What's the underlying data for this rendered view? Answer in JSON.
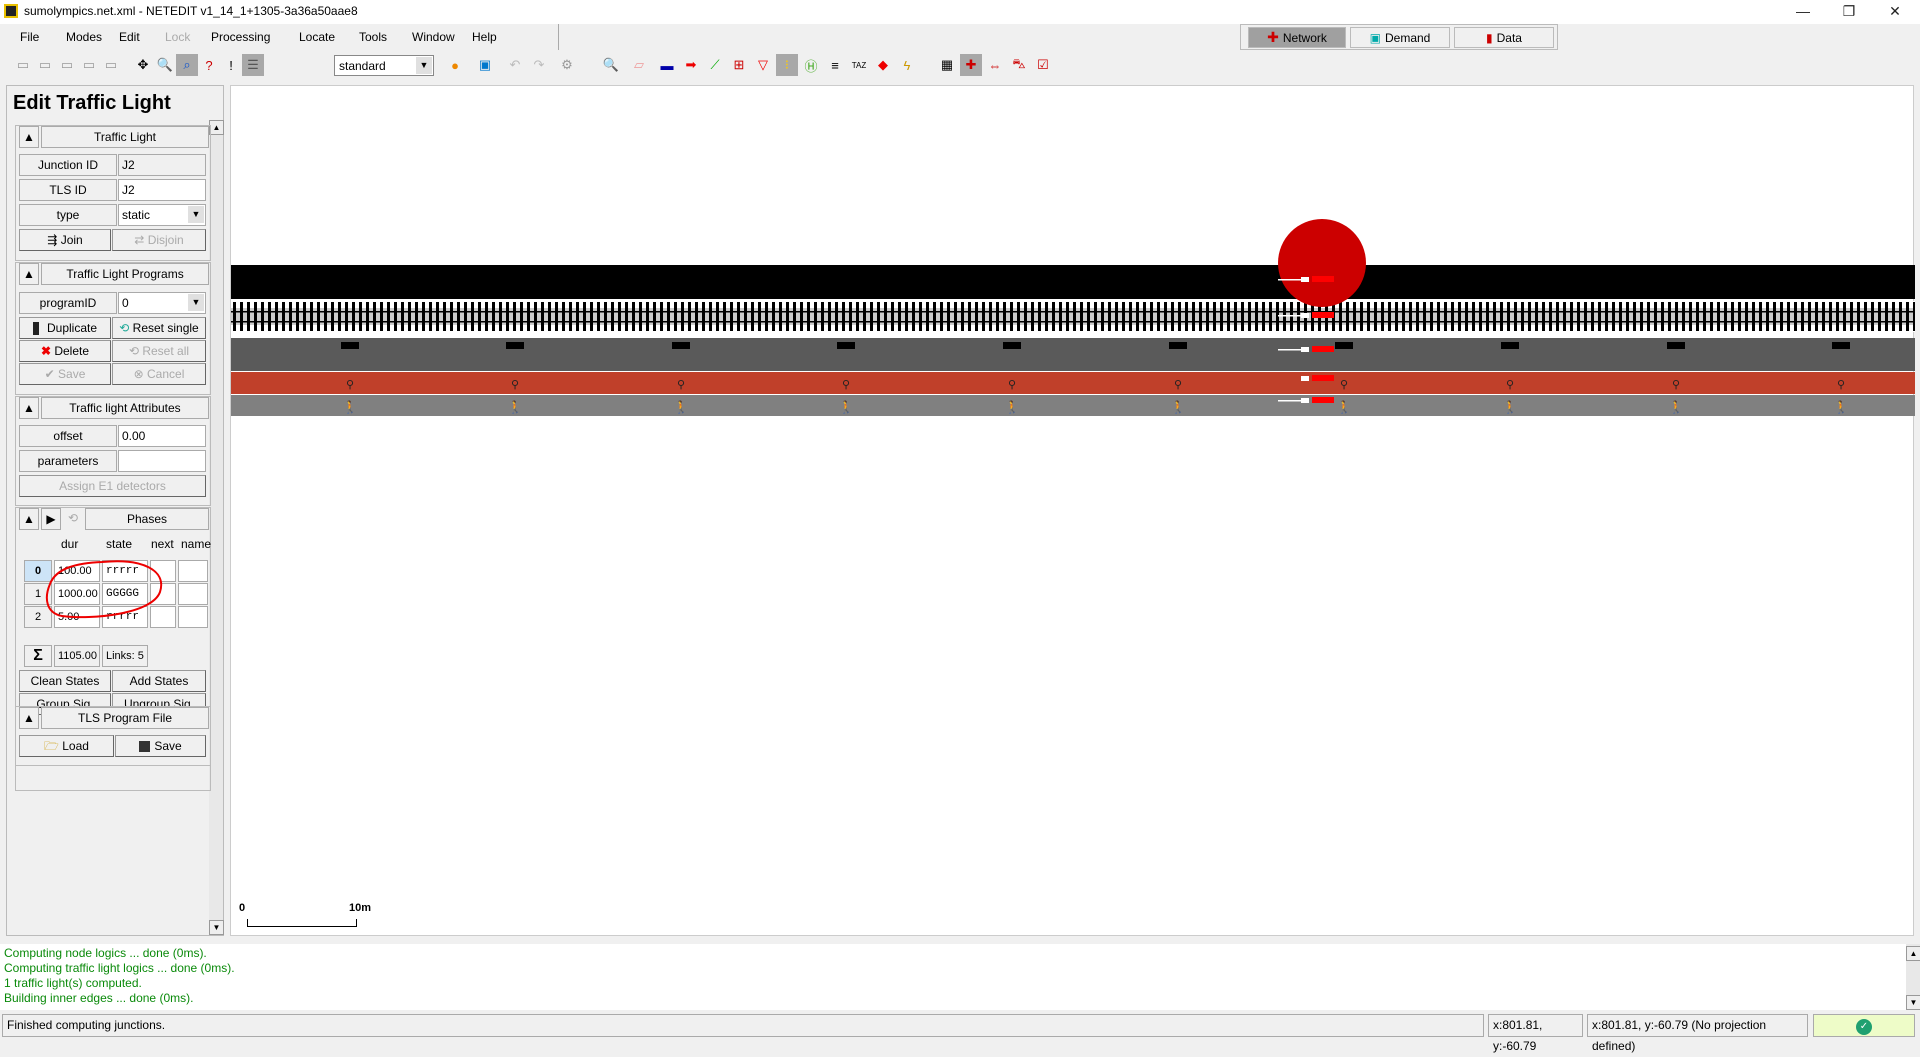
{
  "window": {
    "title": "sumolympics.net.xml - NETEDIT v1_14_1+1305-3a36a50aae8",
    "minimize": "—",
    "maximize": "❐",
    "close": "✕"
  },
  "menu": [
    {
      "label": "File"
    },
    {
      "label": "Modes"
    },
    {
      "label": "Edit"
    },
    {
      "label": "Lock",
      "disabled": true
    },
    {
      "label": "Processing"
    },
    {
      "label": "Locate"
    },
    {
      "label": "Tools"
    },
    {
      "label": "Window"
    },
    {
      "label": "Help"
    }
  ],
  "modes": [
    {
      "label": "Network",
      "icon": "network-icon",
      "active": true
    },
    {
      "label": "Demand",
      "icon": "demand-icon"
    },
    {
      "label": "Data",
      "icon": "data-icon"
    }
  ],
  "toolbar": {
    "scheme": "standard",
    "icons": [
      "save-network-icon",
      "save-additionals-icon",
      "save-tls-icon",
      "save-demand-icon",
      "save-data-icon",
      "recenter-icon",
      "zoom-icon",
      "locate-select-icon",
      "help-icon",
      "inspect-warning-icon",
      "menu-icon",
      "color-wheel-icon",
      "screenshot-icon",
      "undo-icon",
      "redo-icon",
      "options-icon",
      "inspect-mode-icon",
      "delete-mode-icon",
      "select-mode-icon",
      "move-mode-icon",
      "connection-mode-icon",
      "prohibition-mode-icon",
      "crossing-mode-icon",
      "tls-mode-icon",
      "additional-mode-icon",
      "wire-mode-icon",
      "taz-mode-icon",
      "polygon-mode-icon",
      "overhead-wire-icon",
      "grid-icon",
      "junction-shape-icon",
      "spread-vehicles-icon",
      "merge-vehicles-icon",
      "check-tls-icon"
    ]
  },
  "panel": {
    "title": "Edit Traffic Light",
    "traffic_light": {
      "header": "Traffic Light",
      "junction_label": "Junction ID",
      "junction_value": "J2",
      "tls_label": "TLS ID",
      "tls_value": "J2",
      "type_label": "type",
      "type_value": "static",
      "join": "Join",
      "disjoin": "Disjoin"
    },
    "programs": {
      "header": "Traffic Light Programs",
      "program_label": "programID",
      "program_value": "0",
      "duplicate": "Duplicate",
      "reset_single": "Reset single",
      "delete": "Delete",
      "reset_all": "Reset all",
      "save": "Save",
      "cancel": "Cancel"
    },
    "attributes": {
      "header": "Traffic light Attributes",
      "offset_label": "offset",
      "offset_value": "0.00",
      "parameters_label": "parameters",
      "parameters_value": "",
      "assign": "Assign E1 detectors"
    },
    "phases": {
      "header": "Phases",
      "columns": [
        "dur",
        "state",
        "next",
        "name"
      ],
      "rows": [
        {
          "index": "0",
          "dur": "100.00",
          "state": "rrrrr",
          "next": "",
          "name": ""
        },
        {
          "index": "1",
          "dur": "1000.00",
          "state": "GGGGG",
          "next": "",
          "name": ""
        },
        {
          "index": "2",
          "dur": "5.00",
          "state": "rrrrr",
          "next": "",
          "name": ""
        }
      ],
      "sum_symbol": "Σ",
      "sum": "1105.00",
      "links": "Links: 5",
      "clean": "Clean States",
      "add": "Add States",
      "group": "Group Sig.",
      "ungroup": "Ungroup Sig."
    },
    "file": {
      "header": "TLS Program File",
      "load": "Load",
      "save": "Save"
    }
  },
  "canvas": {
    "scale_zero": "0",
    "scale_label": "10m",
    "junction_color": "#cc0000"
  },
  "messages": [
    "Computing node logics ... done (0ms).",
    "Computing traffic light logics ... done (0ms).",
    "1 traffic light(s) computed.",
    "Building inner edges ... done (0ms)."
  ],
  "status": {
    "text": "Finished computing junctions.",
    "coords": "x:801.81, y:-60.79",
    "geo": "x:801.81, y:-60.79 (No projection defined)"
  }
}
